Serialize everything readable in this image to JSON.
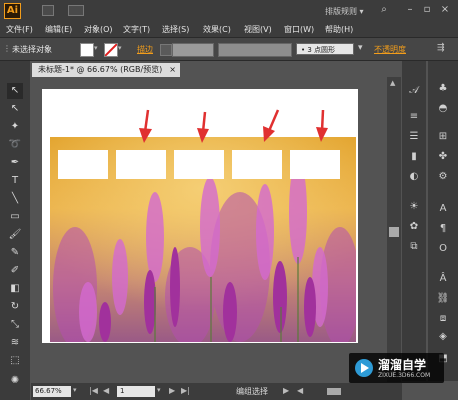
{
  "app": {
    "logo": "Ai",
    "workspace": "排版规则 ▾"
  },
  "menu": [
    "文件(F)",
    "编辑(E)",
    "对象(O)",
    "文字(T)",
    "选择(S)",
    "效果(C)",
    "视图(V)",
    "窗口(W)",
    "帮助(H)"
  ],
  "control": {
    "selection_label": "未选择对象",
    "stroke_label": "描边",
    "points_value": "3 点圆形",
    "opacity_label": "不透明度"
  },
  "document": {
    "tab_title": "未标题-1* @ 66.67% (RGB/预览)",
    "close": "×"
  },
  "status": {
    "zoom": "66.67%",
    "page": "1",
    "tool_name": "编组选择"
  },
  "watermark": {
    "title": "溜溜自学",
    "url": "ZIXUE.3D66.COM"
  },
  "colors": {
    "accent": "#f29d1b",
    "arrow": "#e03030"
  },
  "icons": {
    "left_tools": [
      "selection-icon",
      "direct-selection-icon",
      "magic-wand-icon",
      "lasso-icon",
      "pen-icon",
      "type-icon",
      "line-icon",
      "rectangle-icon",
      "paintbrush-icon",
      "pencil-icon",
      "blob-brush-icon",
      "eraser-icon",
      "rotate-icon",
      "scale-icon",
      "warp-icon",
      "free-transform-icon"
    ],
    "right_dock1": [
      "gradient-panel-icon",
      "type-panel-icon",
      "align-panel-icon",
      "stroke-panel-icon",
      "transparency-panel-icon",
      "appearance-panel-icon",
      "symbols-panel-icon",
      "artboards-panel-icon"
    ],
    "right_dock2": [
      "color-panel-icon",
      "swatches-panel-icon",
      "brushes-panel-icon",
      "character-panel-icon",
      "paragraph-panel-icon",
      "opentype-panel-icon",
      "glyphs-panel-icon",
      "links-panel-icon",
      "layers-panel-icon"
    ]
  }
}
